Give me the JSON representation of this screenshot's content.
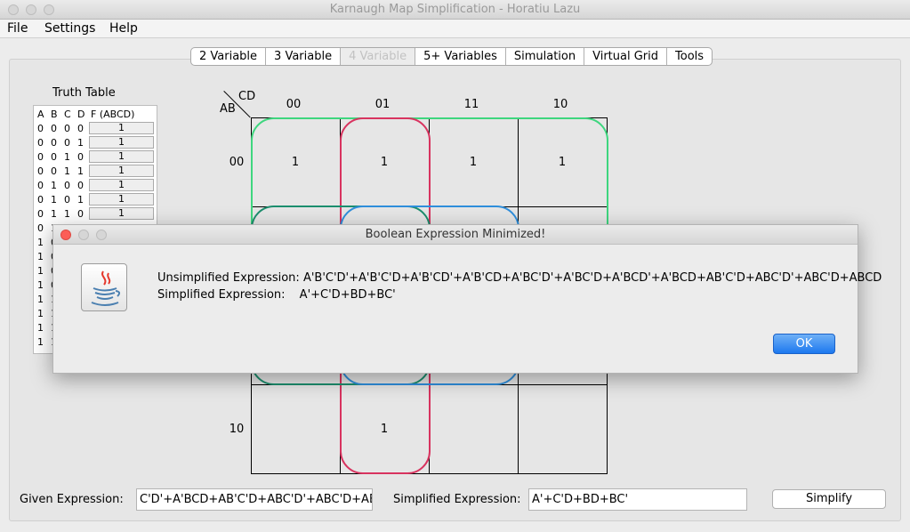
{
  "window": {
    "title": "Karnaugh Map Simplification - Horatiu Lazu"
  },
  "menu": [
    "File",
    "Settings",
    "Help"
  ],
  "tabs": [
    {
      "label": "2 Variable",
      "enabled": true
    },
    {
      "label": "3 Variable",
      "enabled": true
    },
    {
      "label": "4 Variable",
      "enabled": false
    },
    {
      "label": "5+ Variables",
      "enabled": true
    },
    {
      "label": "Simulation",
      "enabled": true
    },
    {
      "label": "Virtual Grid",
      "enabled": true
    },
    {
      "label": "Tools",
      "enabled": true
    }
  ],
  "truth_table": {
    "title": "Truth Table",
    "headers": [
      "A",
      "B",
      "C",
      "D",
      "F (ABCD)"
    ],
    "rows": [
      [
        "0",
        "0",
        "0",
        "0",
        "1"
      ],
      [
        "0",
        "0",
        "0",
        "1",
        "1"
      ],
      [
        "0",
        "0",
        "1",
        "0",
        "1"
      ],
      [
        "0",
        "0",
        "1",
        "1",
        "1"
      ],
      [
        "0",
        "1",
        "0",
        "0",
        "1"
      ],
      [
        "0",
        "1",
        "0",
        "1",
        "1"
      ],
      [
        "0",
        "1",
        "1",
        "0",
        "1"
      ],
      [
        "0",
        "1",
        "",
        "",
        ""
      ],
      [
        "1",
        "0",
        "",
        "",
        ""
      ],
      [
        "1",
        "0",
        "",
        "",
        ""
      ],
      [
        "1",
        "0",
        "",
        "",
        ""
      ],
      [
        "1",
        "0",
        "",
        "",
        ""
      ],
      [
        "1",
        "1",
        "",
        "",
        ""
      ],
      [
        "1",
        "1",
        "",
        "",
        ""
      ],
      [
        "1",
        "1",
        "",
        "",
        ""
      ],
      [
        "1",
        "1",
        "",
        "",
        ""
      ]
    ]
  },
  "kmap": {
    "corner_cd": "CD",
    "corner_ab": "AB",
    "col_labels": [
      "00",
      "01",
      "11",
      "10"
    ],
    "row_labels": [
      "00",
      "10"
    ],
    "row0_values": [
      "1",
      "1",
      "1",
      "1"
    ],
    "row3_values": [
      "",
      "1",
      "",
      ""
    ],
    "group_colors": {
      "green": "#3ed67e",
      "red": "#d8335f",
      "teal": "#1d8e6e",
      "blue": "#2f8fdc"
    }
  },
  "bottom": {
    "given_label": "Given Expression:",
    "given_value": "C'D'+A'BCD+AB'C'D+ABC'D'+ABC'D+ABCD",
    "simplified_label": "Simplified Expression:",
    "simplified_value": "A'+C'D+BD+BC'",
    "simplify_button": "Simplify"
  },
  "dialog": {
    "title": "Boolean Expression Minimized!",
    "unsimplified_label": "Unsimplified Expression:",
    "unsimplified_value": "A'B'C'D'+A'B'C'D+A'B'CD'+A'B'CD+A'BC'D'+A'BC'D+A'BCD'+A'BCD+AB'C'D+ABC'D'+ABC'D+ABCD",
    "simplified_label": "Simplified Expression:",
    "simplified_value": "A'+C'D+BD+BC'",
    "ok_label": "OK",
    "icon": "java-icon"
  }
}
